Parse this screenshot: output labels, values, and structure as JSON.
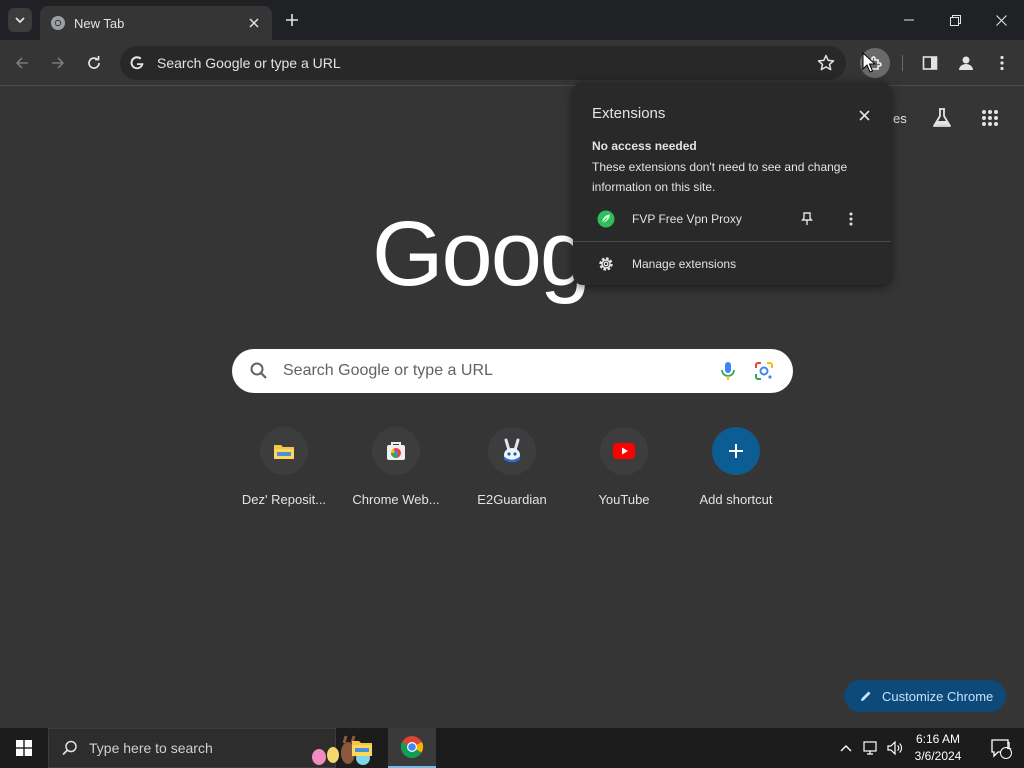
{
  "browser": {
    "tab": {
      "title": "New Tab"
    },
    "omnibox": {
      "placeholder": "Search Google or type a URL"
    }
  },
  "ntp": {
    "topright_partial": "es",
    "logo": "Goog",
    "search": {
      "placeholder": "Search Google or type a URL"
    },
    "shortcuts": [
      {
        "label": "Dez' Reposit...",
        "icon": "folder-icon"
      },
      {
        "label": "Chrome Web...",
        "icon": "chrome-web-store-icon"
      },
      {
        "label": "E2Guardian",
        "icon": "e2guardian-icon"
      },
      {
        "label": "YouTube",
        "icon": "youtube-icon"
      },
      {
        "label": "Add shortcut",
        "icon": "plus-icon"
      }
    ],
    "customize_label": "Customize Chrome"
  },
  "extensions_popup": {
    "title": "Extensions",
    "section_heading": "No access needed",
    "section_desc": "These extensions don't need to see and change information on this site.",
    "items": [
      {
        "name": "FVP Free Vpn Proxy",
        "icon": "vpn-leaf-icon"
      }
    ],
    "manage_label": "Manage extensions"
  },
  "taskbar": {
    "search_placeholder": "Type here to search",
    "time": "6:16 AM",
    "date": "3/6/2024",
    "notification_count": "1"
  },
  "colors": {
    "page_bg": "#353535",
    "titlebar_bg": "#202124",
    "popup_bg": "#292929",
    "customize_bg": "#0d4a7a",
    "add_shortcut_bg": "#0b5d93"
  }
}
